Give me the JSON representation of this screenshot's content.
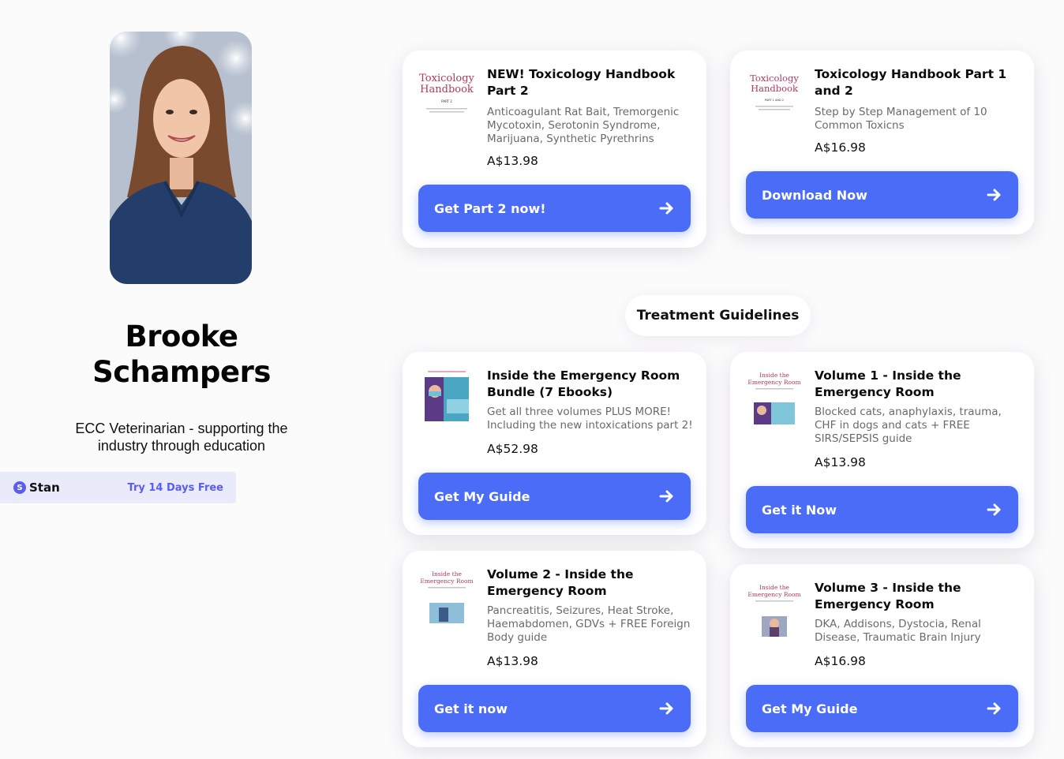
{
  "profile": {
    "name_line1": "Brooke",
    "name_line2": "Schampers",
    "bio_line1": "ECC Veterinarian - supporting the",
    "bio_line2": "industry through education"
  },
  "stan_bar": {
    "logo_glyph": "S",
    "brand": "Stan",
    "cta": "Try 14 Days Free"
  },
  "section": {
    "title": "Treatment Guidelines"
  },
  "thumbs": {
    "tox_title_1": "Toxicology",
    "tox_title_2": "Handbook",
    "tox_part2": "PART 2",
    "tox_part1_2": "PART 1 AND 2",
    "er_title_1": "Inside the",
    "er_title_2": "Emergency Room"
  },
  "cards": [
    {
      "title": "NEW! Toxicology Handbook Part 2",
      "desc": "Anticoagulant Rat Bait, Tremorgenic Mycotoxin, Serotonin Syndrome, Marijuana, Synthetic Pyrethrins",
      "price": "A$13.98",
      "button": "Get Part 2 now!"
    },
    {
      "title": "Toxicology Handbook Part 1 and 2",
      "desc": "Step by Step Management of 10 Common Toxicns",
      "price": "A$16.98",
      "button": "Download Now"
    },
    {
      "title": "Inside the Emergency Room Bundle (7 Ebooks)",
      "desc": "Get all three volumes PLUS MORE! Including the new intoxications part 2!",
      "price": "A$52.98",
      "button": "Get My Guide"
    },
    {
      "title": "Volume 1 - Inside the Emergency Room",
      "desc": "Blocked cats, anaphylaxis, trauma, CHF in dogs and cats + FREE SIRS/SEPSIS guide",
      "price": "A$13.98",
      "button": "Get it Now"
    },
    {
      "title": "Volume 2 - Inside the Emergency Room",
      "desc": "Pancreatitis, Seizures, Heat Stroke, Haemabdomen, GDVs + FREE Foreign Body guide",
      "price": "A$13.98",
      "button": "Get it now"
    },
    {
      "title": "Volume 3 - Inside the Emergency Room",
      "desc": "DKA, Addisons, Dystocia, Renal Disease, Traumatic Brain Injury",
      "price": "A$16.98",
      "button": "Get My Guide"
    }
  ],
  "colors": {
    "button_blue": "#4a6cf7",
    "stan_purple": "#5b5cf0",
    "tox_pink": "#b03a5b",
    "background": "#fcfbfc"
  },
  "icons": {
    "button_arrow": "arrow-right-icon"
  }
}
